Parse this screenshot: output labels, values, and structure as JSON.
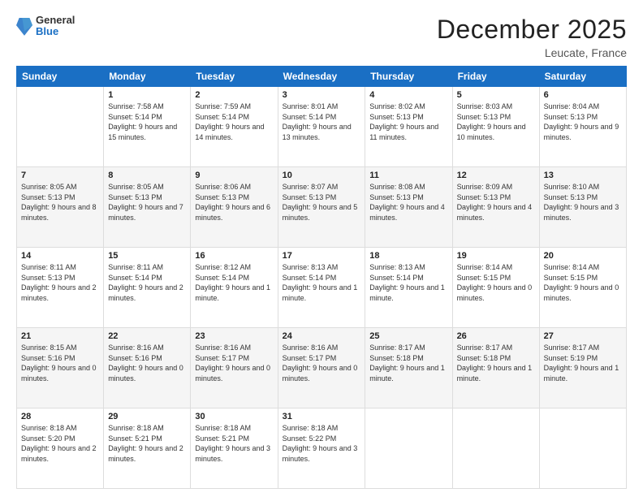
{
  "logo": {
    "general": "General",
    "blue": "Blue"
  },
  "header": {
    "title": "December 2025",
    "location": "Leucate, France"
  },
  "days_of_week": [
    "Sunday",
    "Monday",
    "Tuesday",
    "Wednesday",
    "Thursday",
    "Friday",
    "Saturday"
  ],
  "weeks": [
    [
      {
        "day": "",
        "sunrise": "",
        "sunset": "",
        "daylight": ""
      },
      {
        "day": "1",
        "sunrise": "7:58 AM",
        "sunset": "5:14 PM",
        "daylight": "9 hours and 15 minutes."
      },
      {
        "day": "2",
        "sunrise": "7:59 AM",
        "sunset": "5:14 PM",
        "daylight": "9 hours and 14 minutes."
      },
      {
        "day": "3",
        "sunrise": "8:01 AM",
        "sunset": "5:14 PM",
        "daylight": "9 hours and 13 minutes."
      },
      {
        "day": "4",
        "sunrise": "8:02 AM",
        "sunset": "5:13 PM",
        "daylight": "9 hours and 11 minutes."
      },
      {
        "day": "5",
        "sunrise": "8:03 AM",
        "sunset": "5:13 PM",
        "daylight": "9 hours and 10 minutes."
      },
      {
        "day": "6",
        "sunrise": "8:04 AM",
        "sunset": "5:13 PM",
        "daylight": "9 hours and 9 minutes."
      }
    ],
    [
      {
        "day": "7",
        "sunrise": "8:05 AM",
        "sunset": "5:13 PM",
        "daylight": "9 hours and 8 minutes."
      },
      {
        "day": "8",
        "sunrise": "8:05 AM",
        "sunset": "5:13 PM",
        "daylight": "9 hours and 7 minutes."
      },
      {
        "day": "9",
        "sunrise": "8:06 AM",
        "sunset": "5:13 PM",
        "daylight": "9 hours and 6 minutes."
      },
      {
        "day": "10",
        "sunrise": "8:07 AM",
        "sunset": "5:13 PM",
        "daylight": "9 hours and 5 minutes."
      },
      {
        "day": "11",
        "sunrise": "8:08 AM",
        "sunset": "5:13 PM",
        "daylight": "9 hours and 4 minutes."
      },
      {
        "day": "12",
        "sunrise": "8:09 AM",
        "sunset": "5:13 PM",
        "daylight": "9 hours and 4 minutes."
      },
      {
        "day": "13",
        "sunrise": "8:10 AM",
        "sunset": "5:13 PM",
        "daylight": "9 hours and 3 minutes."
      }
    ],
    [
      {
        "day": "14",
        "sunrise": "8:11 AM",
        "sunset": "5:13 PM",
        "daylight": "9 hours and 2 minutes."
      },
      {
        "day": "15",
        "sunrise": "8:11 AM",
        "sunset": "5:14 PM",
        "daylight": "9 hours and 2 minutes."
      },
      {
        "day": "16",
        "sunrise": "8:12 AM",
        "sunset": "5:14 PM",
        "daylight": "9 hours and 1 minute."
      },
      {
        "day": "17",
        "sunrise": "8:13 AM",
        "sunset": "5:14 PM",
        "daylight": "9 hours and 1 minute."
      },
      {
        "day": "18",
        "sunrise": "8:13 AM",
        "sunset": "5:14 PM",
        "daylight": "9 hours and 1 minute."
      },
      {
        "day": "19",
        "sunrise": "8:14 AM",
        "sunset": "5:15 PM",
        "daylight": "9 hours and 0 minutes."
      },
      {
        "day": "20",
        "sunrise": "8:14 AM",
        "sunset": "5:15 PM",
        "daylight": "9 hours and 0 minutes."
      }
    ],
    [
      {
        "day": "21",
        "sunrise": "8:15 AM",
        "sunset": "5:16 PM",
        "daylight": "9 hours and 0 minutes."
      },
      {
        "day": "22",
        "sunrise": "8:16 AM",
        "sunset": "5:16 PM",
        "daylight": "9 hours and 0 minutes."
      },
      {
        "day": "23",
        "sunrise": "8:16 AM",
        "sunset": "5:17 PM",
        "daylight": "9 hours and 0 minutes."
      },
      {
        "day": "24",
        "sunrise": "8:16 AM",
        "sunset": "5:17 PM",
        "daylight": "9 hours and 0 minutes."
      },
      {
        "day": "25",
        "sunrise": "8:17 AM",
        "sunset": "5:18 PM",
        "daylight": "9 hours and 1 minute."
      },
      {
        "day": "26",
        "sunrise": "8:17 AM",
        "sunset": "5:18 PM",
        "daylight": "9 hours and 1 minute."
      },
      {
        "day": "27",
        "sunrise": "8:17 AM",
        "sunset": "5:19 PM",
        "daylight": "9 hours and 1 minute."
      }
    ],
    [
      {
        "day": "28",
        "sunrise": "8:18 AM",
        "sunset": "5:20 PM",
        "daylight": "9 hours and 2 minutes."
      },
      {
        "day": "29",
        "sunrise": "8:18 AM",
        "sunset": "5:21 PM",
        "daylight": "9 hours and 2 minutes."
      },
      {
        "day": "30",
        "sunrise": "8:18 AM",
        "sunset": "5:21 PM",
        "daylight": "9 hours and 3 minutes."
      },
      {
        "day": "31",
        "sunrise": "8:18 AM",
        "sunset": "5:22 PM",
        "daylight": "9 hours and 3 minutes."
      },
      {
        "day": "",
        "sunrise": "",
        "sunset": "",
        "daylight": ""
      },
      {
        "day": "",
        "sunrise": "",
        "sunset": "",
        "daylight": ""
      },
      {
        "day": "",
        "sunrise": "",
        "sunset": "",
        "daylight": ""
      }
    ]
  ],
  "labels": {
    "sunrise": "Sunrise:",
    "sunset": "Sunset:",
    "daylight": "Daylight:"
  }
}
